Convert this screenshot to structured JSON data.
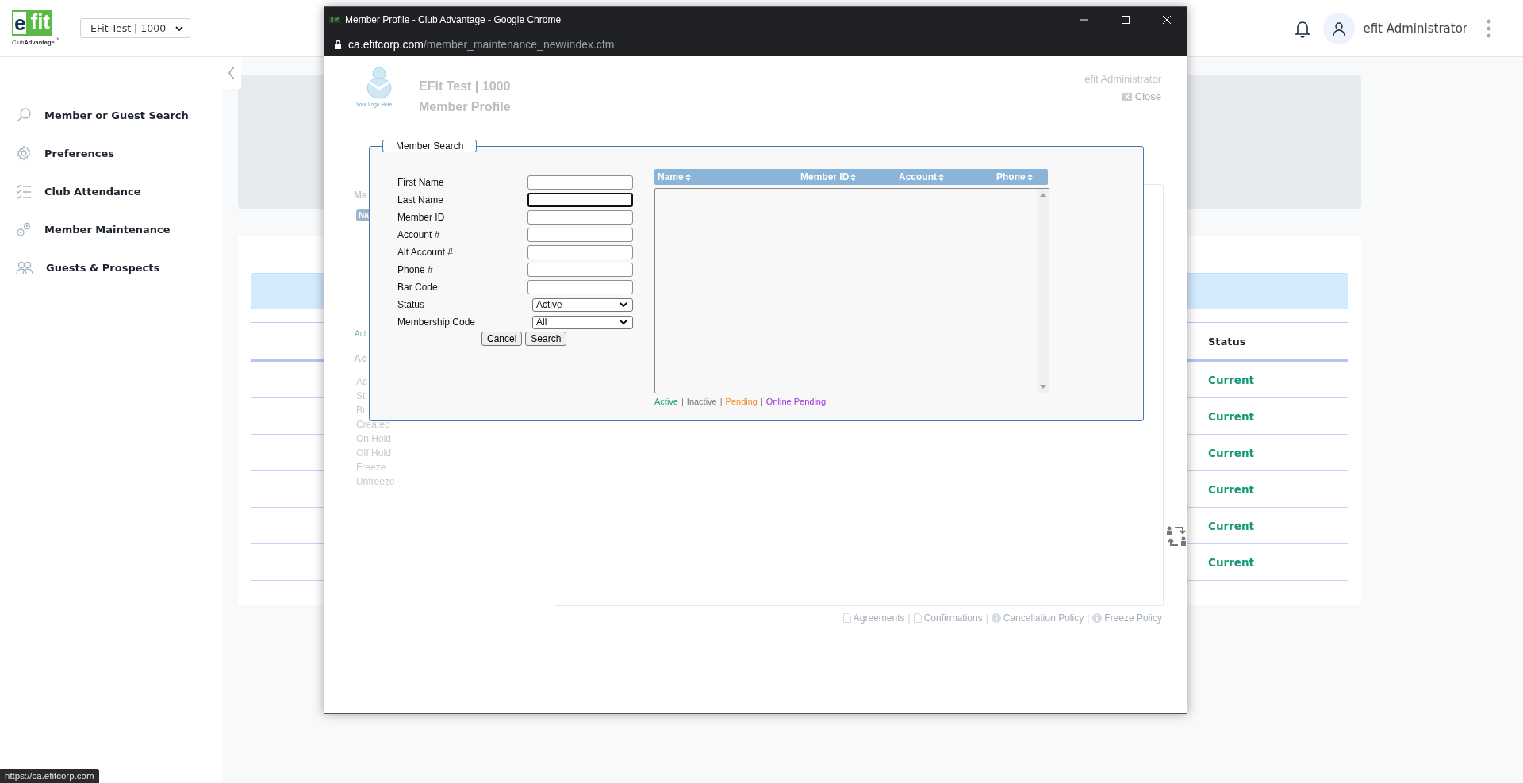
{
  "header": {
    "logo": {
      "mark_dark": "e",
      "mark_light": "fit",
      "wordmark": "Club**Advantage**$^{™}$"
    },
    "club_select": {
      "value": "EFit Test | 1000"
    },
    "user": {
      "name": "efit Administrator"
    }
  },
  "sidebar": {
    "items": [
      {
        "label": "Member or Guest Search",
        "kind": "search"
      },
      {
        "label": "Preferences",
        "kind": "settings"
      },
      {
        "label": "Club Attendance",
        "kind": "attendance"
      },
      {
        "label": "Member Maintenance",
        "kind": "maintenance"
      },
      {
        "label": "Guests & Prospects",
        "kind": "guests"
      }
    ]
  },
  "main": {
    "table": {
      "columns": [
        "Status"
      ],
      "rows": [
        "Current",
        "Current",
        "Current",
        "Current",
        "Current",
        "Current"
      ]
    }
  },
  "popup": {
    "title": "Member Profile - Club Advantage - Google Chrome",
    "url_host": "ca.efitcorp.com",
    "url_path": "/member_maintenance_new/index.cfm",
    "page": {
      "logo_caption": "Your Logo Here",
      "club": "EFit Test | 1000",
      "title": "Member Profile",
      "user": "efit Administrator",
      "close": "Close",
      "background_fragments": {
        "heading": "Me",
        "tab": "Na",
        "link": "Act",
        "section": "Ac",
        "items": [
          "Ac",
          "St",
          "Bi",
          "Created",
          "On Hold",
          "Off Hold",
          "Freeze",
          "Unfreeze"
        ]
      },
      "footer_links": [
        {
          "label": "Agreements",
          "kind": "document"
        },
        {
          "label": "Confirmations",
          "kind": "document"
        },
        {
          "label": "Cancellation Policy",
          "kind": "policy"
        },
        {
          "label": "Freeze Policy",
          "kind": "policy"
        }
      ],
      "footer_separator": "|"
    },
    "dialog": {
      "legend": "Member Search",
      "fields": [
        {
          "label": "First Name",
          "kind": "text",
          "focused": false
        },
        {
          "label": "Last Name",
          "kind": "text",
          "focused": true
        },
        {
          "label": "Member ID",
          "kind": "text",
          "focused": false
        },
        {
          "label": "Account #",
          "kind": "text",
          "focused": false
        },
        {
          "label": "Alt Account #",
          "kind": "text",
          "focused": false
        },
        {
          "label": "Phone #",
          "kind": "text",
          "focused": false
        },
        {
          "label": "Bar Code",
          "kind": "text",
          "focused": false
        },
        {
          "label": "Status",
          "kind": "select",
          "value": "Active"
        },
        {
          "label": "Membership Code",
          "kind": "select",
          "value": "All"
        }
      ],
      "buttons": [
        "Cancel",
        "Search"
      ],
      "results": {
        "columns": [
          "Name",
          "Member ID",
          "Account",
          "Phone"
        ]
      },
      "status_legend": [
        {
          "label": "Active",
          "color": "#1a9a7a"
        },
        {
          "label": "Inactive",
          "color": "#777777"
        },
        {
          "label": "Pending",
          "color": "#f08a24"
        },
        {
          "label": "Online Pending",
          "color": "#9b30d9"
        }
      ],
      "legend_separator": "|"
    }
  },
  "status_bar": {
    "url": "https://ca.efitcorp.com"
  }
}
